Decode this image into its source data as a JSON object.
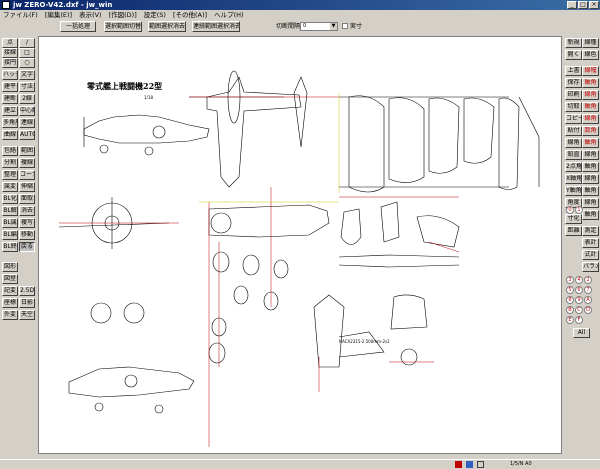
{
  "window": {
    "title": "jw ZERO-V42.dxf - jw_win"
  },
  "menu": [
    "ファイル(F)",
    "[編集(E)]",
    "表示(V)",
    "[作図(D)]",
    "設定(S)",
    "[その他(A)]",
    "ヘルプ(H)"
  ],
  "toolbar": {
    "buttons": [
      "一括処理",
      "選択範囲切替",
      "範囲選択消去",
      "連続範囲選択消去"
    ],
    "cut_label": "切断間隔",
    "cut_value": "0",
    "actual_label": "実寸"
  },
  "left_tools": [
    "点",
    "接線",
    "接円",
    "ハッチ",
    "建平",
    "建断",
    "建立",
    "多角形",
    "曲線",
    "包絡",
    "分割",
    "整理",
    "属変",
    "BL化",
    "BL解",
    "BL属",
    "BL編",
    "BL終",
    "図形",
    "図登",
    "記変",
    "座標",
    "外変"
  ],
  "left_tools_col2": [
    "/",
    "□",
    "○",
    "文字",
    "寸法",
    "2線",
    "中心線",
    "連線",
    "AUTO",
    "範囲",
    "複線",
    "コーナー",
    "伸縮",
    "面取",
    "消去",
    "複写",
    "移動",
    "戻る",
    "2.5D",
    "日影",
    "天空"
  ],
  "right_tools": [
    "新規",
    "開く",
    "上書",
    "保存",
    "印刷",
    "切取",
    "コピー",
    "貼付",
    "線角",
    "鉛直",
    "2点角",
    "X軸角",
    "Y軸角",
    "角度",
    "寸化",
    "距離",
    "測定",
    "表計",
    "式計",
    "パラメ"
  ],
  "right_tools_col2": [
    "線種",
    "線色",
    "線幅",
    "軸角",
    "線角",
    "軸角",
    "線角",
    "数角",
    "軸角",
    "線角",
    "軸角",
    "線角",
    "軸角",
    "線角",
    "軸角"
  ],
  "layers": [
    "0",
    "1",
    "2",
    "3",
    "4",
    "5",
    "6",
    "7",
    "8",
    "9",
    "A",
    "B",
    "C",
    "D",
    "E",
    "F"
  ],
  "layer_all": "All",
  "drawing": {
    "title": "零式艦上戦闘機22型",
    "subtitle": "1/18",
    "note": "NACA2315-2 500mm-2s2"
  },
  "status": {
    "text": "",
    "scale": "1/5/N  A0",
    "icons": [
      "layer-icon",
      "color-icon",
      "grid-icon"
    ]
  }
}
